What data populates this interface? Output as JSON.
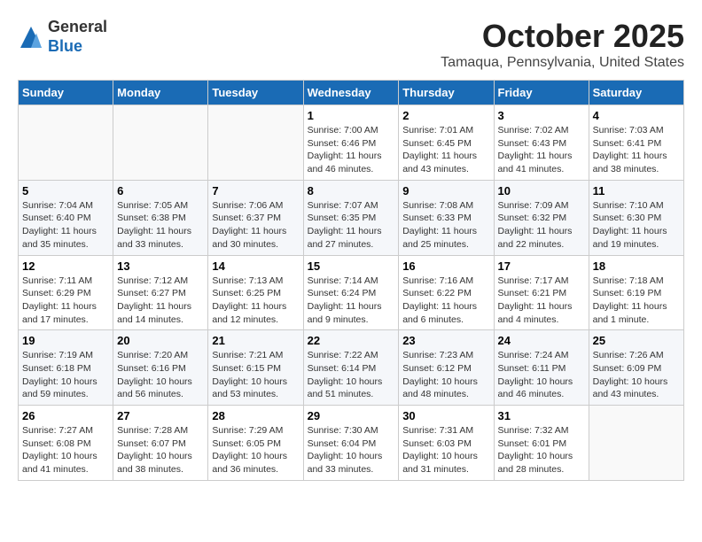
{
  "header": {
    "logo_line1": "General",
    "logo_line2": "Blue",
    "month": "October 2025",
    "location": "Tamaqua, Pennsylvania, United States"
  },
  "weekdays": [
    "Sunday",
    "Monday",
    "Tuesday",
    "Wednesday",
    "Thursday",
    "Friday",
    "Saturday"
  ],
  "weeks": [
    [
      {
        "day": "",
        "info": ""
      },
      {
        "day": "",
        "info": ""
      },
      {
        "day": "",
        "info": ""
      },
      {
        "day": "1",
        "info": "Sunrise: 7:00 AM\nSunset: 6:46 PM\nDaylight: 11 hours\nand 46 minutes."
      },
      {
        "day": "2",
        "info": "Sunrise: 7:01 AM\nSunset: 6:45 PM\nDaylight: 11 hours\nand 43 minutes."
      },
      {
        "day": "3",
        "info": "Sunrise: 7:02 AM\nSunset: 6:43 PM\nDaylight: 11 hours\nand 41 minutes."
      },
      {
        "day": "4",
        "info": "Sunrise: 7:03 AM\nSunset: 6:41 PM\nDaylight: 11 hours\nand 38 minutes."
      }
    ],
    [
      {
        "day": "5",
        "info": "Sunrise: 7:04 AM\nSunset: 6:40 PM\nDaylight: 11 hours\nand 35 minutes."
      },
      {
        "day": "6",
        "info": "Sunrise: 7:05 AM\nSunset: 6:38 PM\nDaylight: 11 hours\nand 33 minutes."
      },
      {
        "day": "7",
        "info": "Sunrise: 7:06 AM\nSunset: 6:37 PM\nDaylight: 11 hours\nand 30 minutes."
      },
      {
        "day": "8",
        "info": "Sunrise: 7:07 AM\nSunset: 6:35 PM\nDaylight: 11 hours\nand 27 minutes."
      },
      {
        "day": "9",
        "info": "Sunrise: 7:08 AM\nSunset: 6:33 PM\nDaylight: 11 hours\nand 25 minutes."
      },
      {
        "day": "10",
        "info": "Sunrise: 7:09 AM\nSunset: 6:32 PM\nDaylight: 11 hours\nand 22 minutes."
      },
      {
        "day": "11",
        "info": "Sunrise: 7:10 AM\nSunset: 6:30 PM\nDaylight: 11 hours\nand 19 minutes."
      }
    ],
    [
      {
        "day": "12",
        "info": "Sunrise: 7:11 AM\nSunset: 6:29 PM\nDaylight: 11 hours\nand 17 minutes."
      },
      {
        "day": "13",
        "info": "Sunrise: 7:12 AM\nSunset: 6:27 PM\nDaylight: 11 hours\nand 14 minutes."
      },
      {
        "day": "14",
        "info": "Sunrise: 7:13 AM\nSunset: 6:25 PM\nDaylight: 11 hours\nand 12 minutes."
      },
      {
        "day": "15",
        "info": "Sunrise: 7:14 AM\nSunset: 6:24 PM\nDaylight: 11 hours\nand 9 minutes."
      },
      {
        "day": "16",
        "info": "Sunrise: 7:16 AM\nSunset: 6:22 PM\nDaylight: 11 hours\nand 6 minutes."
      },
      {
        "day": "17",
        "info": "Sunrise: 7:17 AM\nSunset: 6:21 PM\nDaylight: 11 hours\nand 4 minutes."
      },
      {
        "day": "18",
        "info": "Sunrise: 7:18 AM\nSunset: 6:19 PM\nDaylight: 11 hours\nand 1 minute."
      }
    ],
    [
      {
        "day": "19",
        "info": "Sunrise: 7:19 AM\nSunset: 6:18 PM\nDaylight: 10 hours\nand 59 minutes."
      },
      {
        "day": "20",
        "info": "Sunrise: 7:20 AM\nSunset: 6:16 PM\nDaylight: 10 hours\nand 56 minutes."
      },
      {
        "day": "21",
        "info": "Sunrise: 7:21 AM\nSunset: 6:15 PM\nDaylight: 10 hours\nand 53 minutes."
      },
      {
        "day": "22",
        "info": "Sunrise: 7:22 AM\nSunset: 6:14 PM\nDaylight: 10 hours\nand 51 minutes."
      },
      {
        "day": "23",
        "info": "Sunrise: 7:23 AM\nSunset: 6:12 PM\nDaylight: 10 hours\nand 48 minutes."
      },
      {
        "day": "24",
        "info": "Sunrise: 7:24 AM\nSunset: 6:11 PM\nDaylight: 10 hours\nand 46 minutes."
      },
      {
        "day": "25",
        "info": "Sunrise: 7:26 AM\nSunset: 6:09 PM\nDaylight: 10 hours\nand 43 minutes."
      }
    ],
    [
      {
        "day": "26",
        "info": "Sunrise: 7:27 AM\nSunset: 6:08 PM\nDaylight: 10 hours\nand 41 minutes."
      },
      {
        "day": "27",
        "info": "Sunrise: 7:28 AM\nSunset: 6:07 PM\nDaylight: 10 hours\nand 38 minutes."
      },
      {
        "day": "28",
        "info": "Sunrise: 7:29 AM\nSunset: 6:05 PM\nDaylight: 10 hours\nand 36 minutes."
      },
      {
        "day": "29",
        "info": "Sunrise: 7:30 AM\nSunset: 6:04 PM\nDaylight: 10 hours\nand 33 minutes."
      },
      {
        "day": "30",
        "info": "Sunrise: 7:31 AM\nSunset: 6:03 PM\nDaylight: 10 hours\nand 31 minutes."
      },
      {
        "day": "31",
        "info": "Sunrise: 7:32 AM\nSunset: 6:01 PM\nDaylight: 10 hours\nand 28 minutes."
      },
      {
        "day": "",
        "info": ""
      }
    ]
  ]
}
